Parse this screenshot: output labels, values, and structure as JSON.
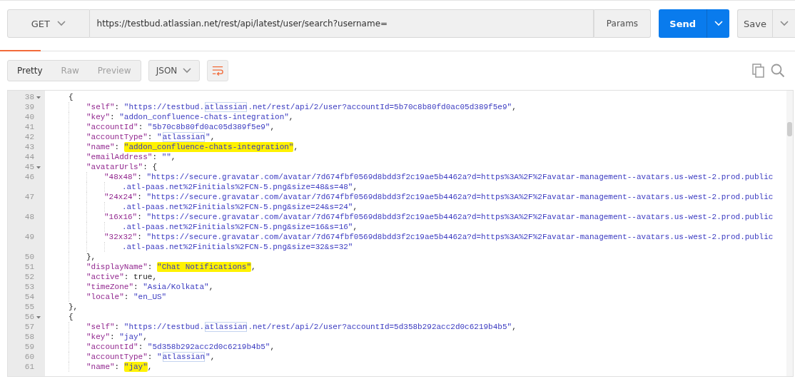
{
  "request": {
    "method": "GET",
    "url": "https://testbud.atlassian.net/rest/api/latest/user/search?username=",
    "params_label": "Params",
    "send_label": "Send",
    "save_label": "Save"
  },
  "response_toolbar": {
    "view_tabs": [
      {
        "label": "Pretty",
        "selected": true
      },
      {
        "label": "Raw",
        "selected": false
      },
      {
        "label": "Preview",
        "selected": false
      }
    ],
    "format": "JSON"
  },
  "code_lines": [
    {
      "number": "38",
      "foldable": true,
      "parts": [
        {
          "kind": "punct",
          "text": "{"
        }
      ],
      "children": [
        {
          "number": "39",
          "foldable": false,
          "parts": [
            {
              "kind": "key",
              "text": "\"self\""
            },
            {
              "kind": "punct",
              "text": ": "
            },
            {
              "kind": "string",
              "text": "\"https://testbud."
            },
            {
              "kind": "boxed",
              "text": "atlassian"
            },
            {
              "kind": "string",
              "text": ".net/rest/api/2/user?accountId=5b70c8b80fd0ac05d389f5e9\""
            },
            {
              "kind": "punct",
              "text": ","
            }
          ]
        },
        {
          "number": "40",
          "foldable": false,
          "parts": [
            {
              "kind": "key",
              "text": "\"key\""
            },
            {
              "kind": "punct",
              "text": ": "
            },
            {
              "kind": "string",
              "text": "\"addon_confluence-chats-integration\""
            },
            {
              "kind": "punct",
              "text": ","
            }
          ]
        },
        {
          "number": "41",
          "foldable": false,
          "parts": [
            {
              "kind": "key",
              "text": "\"accountId\""
            },
            {
              "kind": "punct",
              "text": ": "
            },
            {
              "kind": "string",
              "text": "\"5b70c8b80fd0ac05d389f5e9\""
            },
            {
              "kind": "punct",
              "text": ","
            }
          ]
        },
        {
          "number": "42",
          "foldable": false,
          "parts": [
            {
              "kind": "key",
              "text": "\"accountType\""
            },
            {
              "kind": "punct",
              "text": ": "
            },
            {
              "kind": "string",
              "text": "\""
            },
            {
              "kind": "boxed",
              "text": "atlassian"
            },
            {
              "kind": "string",
              "text": "\""
            },
            {
              "kind": "punct",
              "text": ","
            }
          ]
        },
        {
          "number": "43",
          "foldable": false,
          "parts": [
            {
              "kind": "key",
              "text": "\"name\""
            },
            {
              "kind": "punct",
              "text": ": "
            },
            {
              "kind": "highlight",
              "text": "\"addon_confluence-chats-integration\""
            },
            {
              "kind": "punct",
              "text": ","
            }
          ]
        },
        {
          "number": "44",
          "foldable": false,
          "parts": [
            {
              "kind": "key",
              "text": "\"emailAddress\""
            },
            {
              "kind": "punct",
              "text": ": "
            },
            {
              "kind": "string",
              "text": "\"\""
            },
            {
              "kind": "punct",
              "text": ","
            }
          ]
        },
        {
          "number": "45",
          "foldable": true,
          "parts": [
            {
              "kind": "key",
              "text": "\"avatarUrls\""
            },
            {
              "kind": "punct",
              "text": ": {"
            }
          ],
          "children": [
            {
              "number": "46",
              "foldable": false,
              "parts": [
                {
                  "kind": "key",
                  "text": "\"48x48\""
                },
                {
                  "kind": "punct",
                  "text": ": "
                },
                {
                  "kind": "string",
                  "text": "\"https://secure.gravatar.com/avatar/7d674fbf0569d8bdd3f2c19ae5b4462a?d=https%3A%2F%2Favatar-management--avatars.us-west-2.prod.public"
                }
              ],
              "wrap": [
                {
                  "kind": "string",
                  "text": ".atl-paas.net%2Finitials%2FCN-5.png&size=48&s=48\""
                },
                {
                  "kind": "punct",
                  "text": ","
                }
              ]
            },
            {
              "number": "47",
              "foldable": false,
              "parts": [
                {
                  "kind": "key",
                  "text": "\"24x24\""
                },
                {
                  "kind": "punct",
                  "text": ": "
                },
                {
                  "kind": "string",
                  "text": "\"https://secure.gravatar.com/avatar/7d674fbf0569d8bdd3f2c19ae5b4462a?d=https%3A%2F%2Favatar-management--avatars.us-west-2.prod.public"
                }
              ],
              "wrap": [
                {
                  "kind": "string",
                  "text": ".atl-paas.net%2Finitials%2FCN-5.png&size=24&s=24\""
                },
                {
                  "kind": "punct",
                  "text": ","
                }
              ]
            },
            {
              "number": "48",
              "foldable": false,
              "parts": [
                {
                  "kind": "key",
                  "text": "\"16x16\""
                },
                {
                  "kind": "punct",
                  "text": ": "
                },
                {
                  "kind": "string",
                  "text": "\"https://secure.gravatar.com/avatar/7d674fbf0569d8bdd3f2c19ae5b4462a?d=https%3A%2F%2Favatar-management--avatars.us-west-2.prod.public"
                }
              ],
              "wrap": [
                {
                  "kind": "string",
                  "text": ".atl-paas.net%2Finitials%2FCN-5.png&size=16&s=16\""
                },
                {
                  "kind": "punct",
                  "text": ","
                }
              ]
            },
            {
              "number": "49",
              "foldable": false,
              "parts": [
                {
                  "kind": "key",
                  "text": "\"32x32\""
                },
                {
                  "kind": "punct",
                  "text": ": "
                },
                {
                  "kind": "string",
                  "text": "\"https://secure.gravatar.com/avatar/7d674fbf0569d8bdd3f2c19ae5b4462a?d=https%3A%2F%2Favatar-management--avatars.us-west-2.prod.public"
                }
              ],
              "wrap": [
                {
                  "kind": "string",
                  "text": ".atl-paas.net%2Finitials%2FCN-5.png&size=32&s=32\""
                }
              ]
            }
          ]
        },
        {
          "number": "50",
          "foldable": false,
          "parts": [
            {
              "kind": "punct",
              "text": "},"
            }
          ]
        },
        {
          "number": "51",
          "foldable": false,
          "parts": [
            {
              "kind": "key",
              "text": "\"displayName\""
            },
            {
              "kind": "punct",
              "text": ": "
            },
            {
              "kind": "highlight",
              "text": "\"Chat Notifications\""
            },
            {
              "kind": "punct",
              "text": ","
            }
          ]
        },
        {
          "number": "52",
          "foldable": false,
          "parts": [
            {
              "kind": "key",
              "text": "\"active\""
            },
            {
              "kind": "punct",
              "text": ": "
            },
            {
              "kind": "literal",
              "text": "true"
            },
            {
              "kind": "punct",
              "text": ","
            }
          ]
        },
        {
          "number": "53",
          "foldable": false,
          "parts": [
            {
              "kind": "key",
              "text": "\"timeZone\""
            },
            {
              "kind": "punct",
              "text": ": "
            },
            {
              "kind": "string",
              "text": "\"Asia/Kolkata\""
            },
            {
              "kind": "punct",
              "text": ","
            }
          ]
        },
        {
          "number": "54",
          "foldable": false,
          "parts": [
            {
              "kind": "key",
              "text": "\"locale\""
            },
            {
              "kind": "punct",
              "text": ": "
            },
            {
              "kind": "string",
              "text": "\"en_US\""
            }
          ]
        }
      ]
    },
    {
      "number": "55",
      "foldable": false,
      "parts": [
        {
          "kind": "punct",
          "text": "},"
        }
      ]
    },
    {
      "number": "56",
      "foldable": true,
      "parts": [
        {
          "kind": "punct",
          "text": "{"
        }
      ],
      "children": [
        {
          "number": "57",
          "foldable": false,
          "parts": [
            {
              "kind": "key",
              "text": "\"self\""
            },
            {
              "kind": "punct",
              "text": ": "
            },
            {
              "kind": "string",
              "text": "\"https://testbud."
            },
            {
              "kind": "boxed",
              "text": "atlassian"
            },
            {
              "kind": "string",
              "text": ".net/rest/api/2/user?accountId=5d358b292acc2d0c6219b4b5\""
            },
            {
              "kind": "punct",
              "text": ","
            }
          ]
        },
        {
          "number": "58",
          "foldable": false,
          "parts": [
            {
              "kind": "key",
              "text": "\"key\""
            },
            {
              "kind": "punct",
              "text": ": "
            },
            {
              "kind": "string",
              "text": "\"jay\""
            },
            {
              "kind": "punct",
              "text": ","
            }
          ]
        },
        {
          "number": "59",
          "foldable": false,
          "parts": [
            {
              "kind": "key",
              "text": "\"accountId\""
            },
            {
              "kind": "punct",
              "text": ": "
            },
            {
              "kind": "string",
              "text": "\"5d358b292acc2d0c6219b4b5\""
            },
            {
              "kind": "punct",
              "text": ","
            }
          ]
        },
        {
          "number": "60",
          "foldable": false,
          "parts": [
            {
              "kind": "key",
              "text": "\"accountType\""
            },
            {
              "kind": "punct",
              "text": ": "
            },
            {
              "kind": "string",
              "text": "\""
            },
            {
              "kind": "boxed",
              "text": "atlassian"
            },
            {
              "kind": "string",
              "text": "\""
            },
            {
              "kind": "punct",
              "text": ","
            }
          ]
        },
        {
          "number": "61",
          "foldable": false,
          "parts": [
            {
              "kind": "key",
              "text": "\"name\""
            },
            {
              "kind": "punct",
              "text": ": "
            },
            {
              "kind": "highlight",
              "text": "\"jay\""
            },
            {
              "kind": "punct",
              "text": ","
            }
          ]
        }
      ]
    }
  ]
}
